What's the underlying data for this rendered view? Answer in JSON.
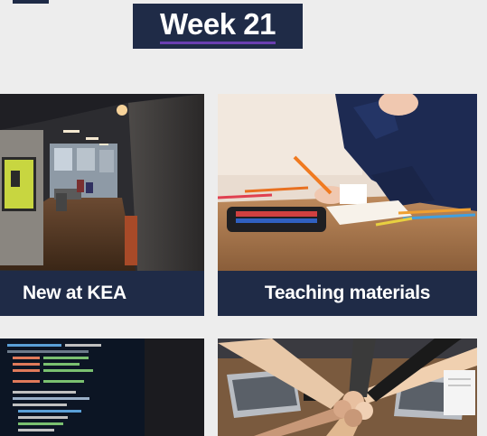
{
  "header": {
    "week_title": "Week 21"
  },
  "cards": [
    {
      "label": "New at KEA",
      "image_icon": "office-hallway-photo"
    },
    {
      "label": "Teaching materials",
      "image_icon": "student-writing-photo"
    },
    {
      "label": "",
      "image_icon": "code-screen-photo"
    },
    {
      "label": "",
      "image_icon": "team-fists-photo"
    }
  ],
  "colors": {
    "navy": "#1f2b47",
    "accent_underline": "#6a3fb0",
    "background": "#ededed"
  }
}
